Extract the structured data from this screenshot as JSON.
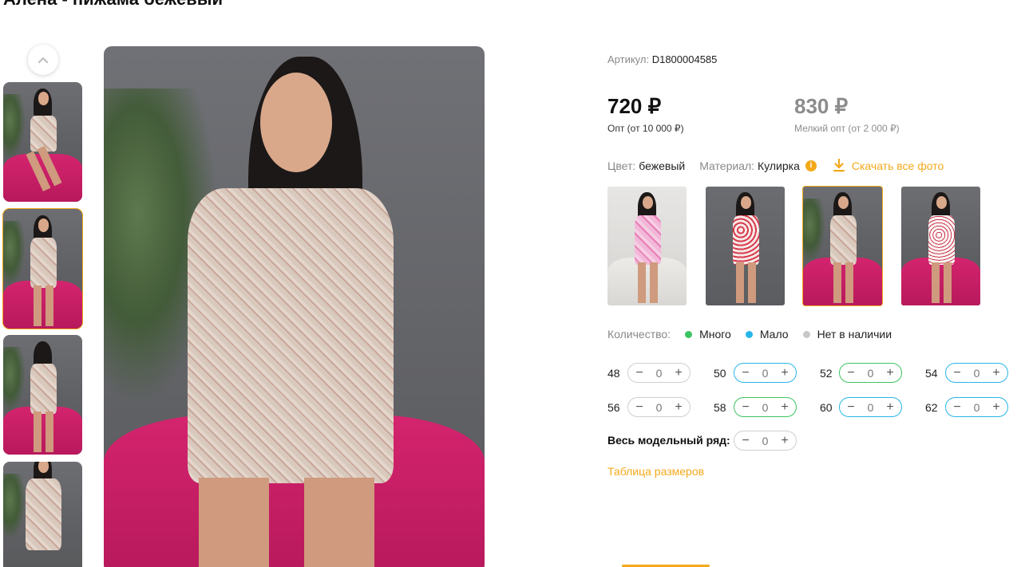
{
  "product": {
    "title": "Алена - пижама бежевый"
  },
  "sku": {
    "label": "Артикул:",
    "value": "D1800004585"
  },
  "prices": {
    "wholesale": {
      "value": "720 ₽",
      "label": "Опт (от 10 000 ₽)"
    },
    "small_wholesale": {
      "value": "830 ₽",
      "label": "Мелкий опт (от 2 000 ₽)"
    }
  },
  "attributes": {
    "color_label": "Цвет:",
    "color_value": "бежевый",
    "material_label": "Материал:",
    "material_value": "Кулирка",
    "info_icon": "i",
    "download_label": "Скачать все фото",
    "download_icon": "download-icon"
  },
  "stock": {
    "label": "Количество:",
    "levels": [
      {
        "label": "Много",
        "color": "#3cc461"
      },
      {
        "label": "Мало",
        "color": "#27b5e8"
      },
      {
        "label": "Нет в наличии",
        "color": "#c8c8c8"
      }
    ]
  },
  "sizes": [
    {
      "size": "48",
      "qty": "0",
      "stock": "none"
    },
    {
      "size": "50",
      "qty": "0",
      "stock": "low"
    },
    {
      "size": "52",
      "qty": "0",
      "stock": "many"
    },
    {
      "size": "54",
      "qty": "0",
      "stock": "low"
    },
    {
      "size": "56",
      "qty": "0",
      "stock": "none"
    },
    {
      "size": "58",
      "qty": "0",
      "stock": "many"
    },
    {
      "size": "60",
      "qty": "0",
      "stock": "low"
    },
    {
      "size": "62",
      "qty": "0",
      "stock": "low"
    }
  ],
  "full_range": {
    "label": "Весь модельный ряд:",
    "qty": "0"
  },
  "stepper": {
    "minus": "−",
    "plus": "+"
  },
  "size_table_link": "Таблица размеров",
  "gallery": {
    "up_icon": "chevron-up-icon",
    "active_thumbnail": 2,
    "thumbnail_count": 4
  },
  "variants": {
    "count": 4,
    "active": 3
  },
  "colors": {
    "accent": "#f4a91b",
    "many": "#3cc461",
    "low": "#27b5e8",
    "none": "#c8c8c8"
  }
}
